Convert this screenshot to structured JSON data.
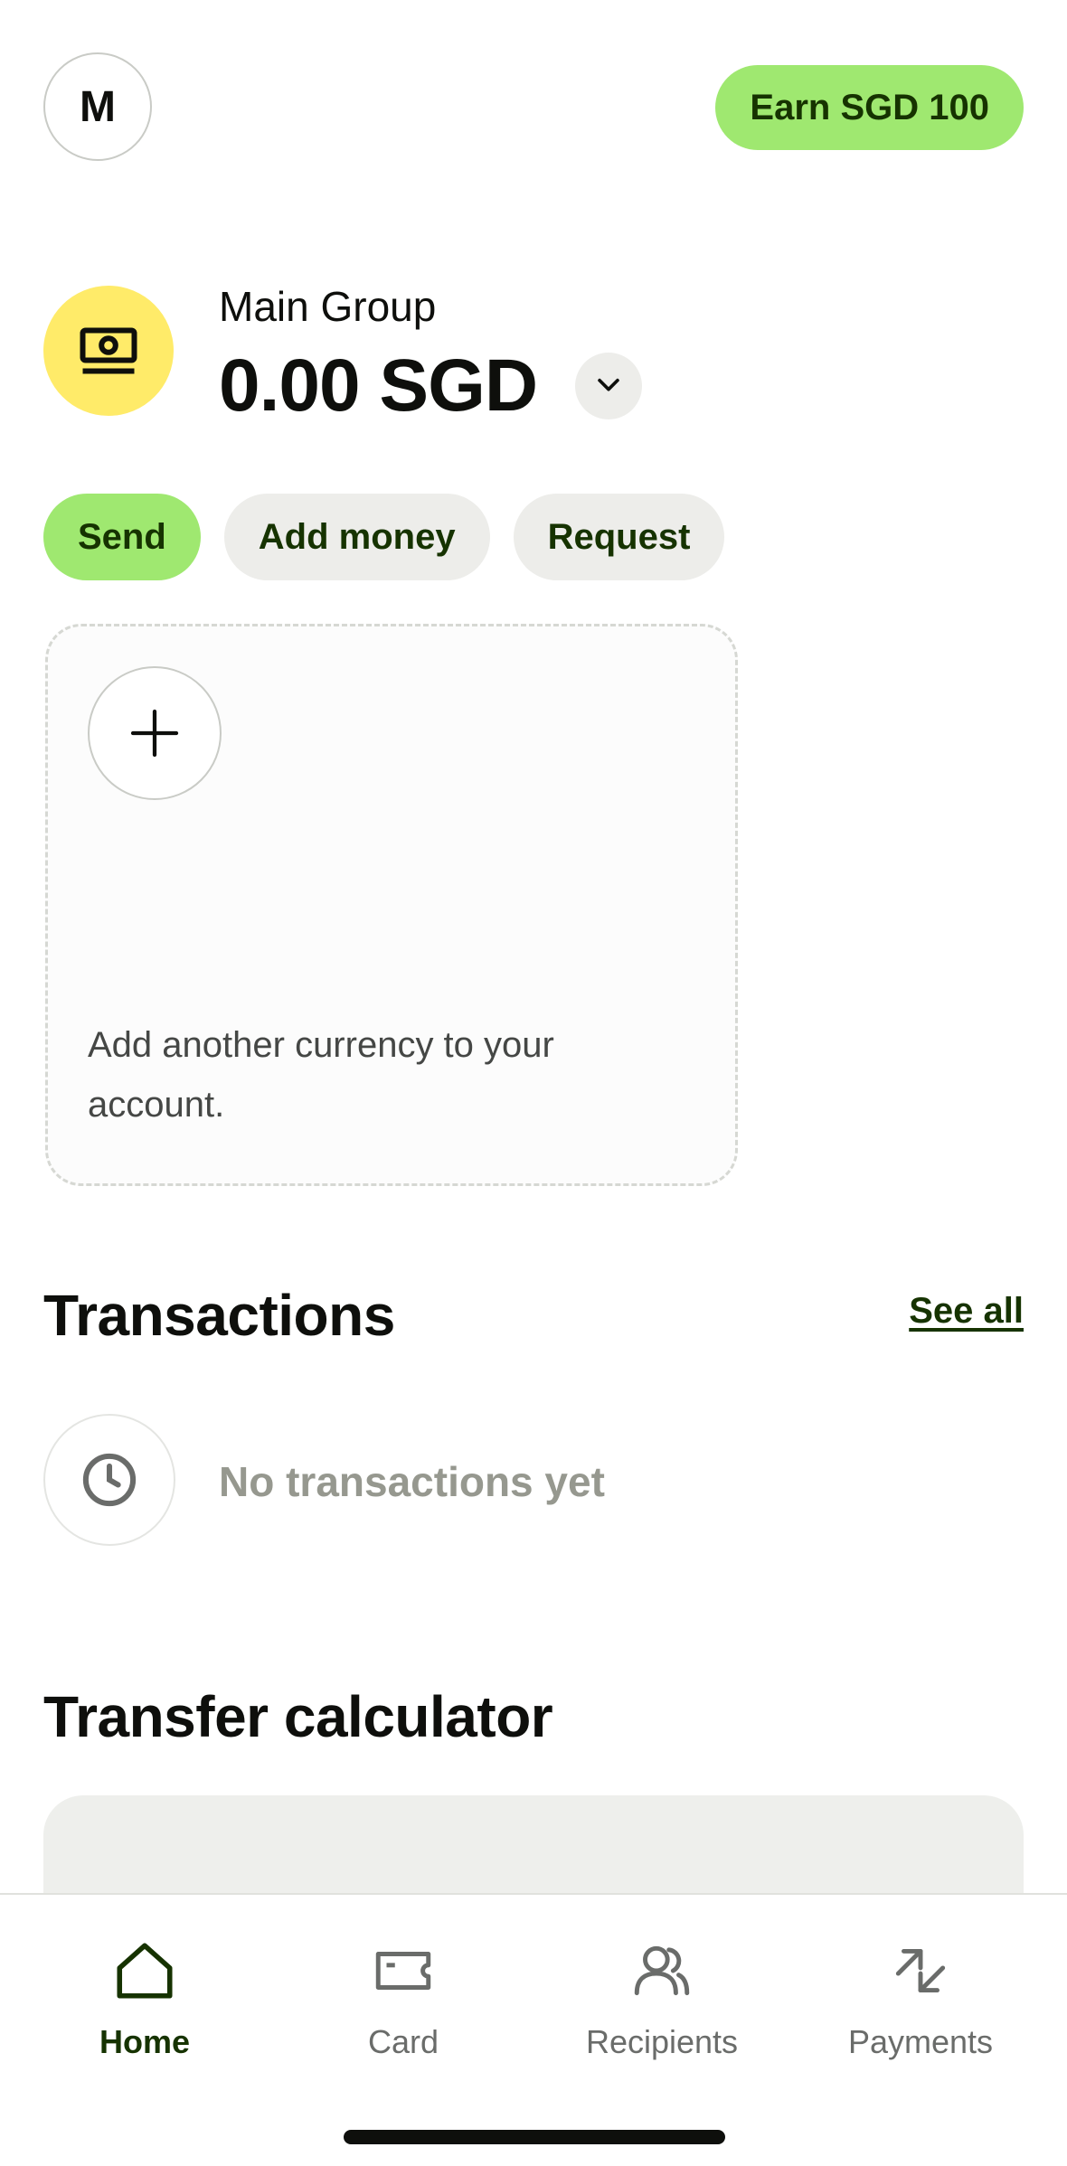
{
  "header": {
    "avatar_initial": "M",
    "earn_label": "Earn SGD 100"
  },
  "balance": {
    "group_name": "Main Group",
    "amount": "0.00 SGD",
    "icon": "banknote-icon"
  },
  "actions": {
    "send_label": "Send",
    "add_money_label": "Add money",
    "request_label": "Request"
  },
  "add_currency": {
    "text": "Add another currency to your account."
  },
  "transactions": {
    "title": "Transactions",
    "see_all_label": "See all",
    "empty_text": "No transactions yet"
  },
  "calculator": {
    "title": "Transfer calculator"
  },
  "nav": {
    "items": [
      {
        "label": "Home",
        "icon": "home-icon",
        "active": true
      },
      {
        "label": "Card",
        "icon": "card-icon",
        "active": false
      },
      {
        "label": "Recipients",
        "icon": "recipients-icon",
        "active": false
      },
      {
        "label": "Payments",
        "icon": "payments-icon",
        "active": false
      }
    ]
  },
  "colors": {
    "accent_green": "#9fe870",
    "dark_green": "#163300",
    "balance_icon_bg": "#ffeb69",
    "muted_text": "#96988f"
  }
}
